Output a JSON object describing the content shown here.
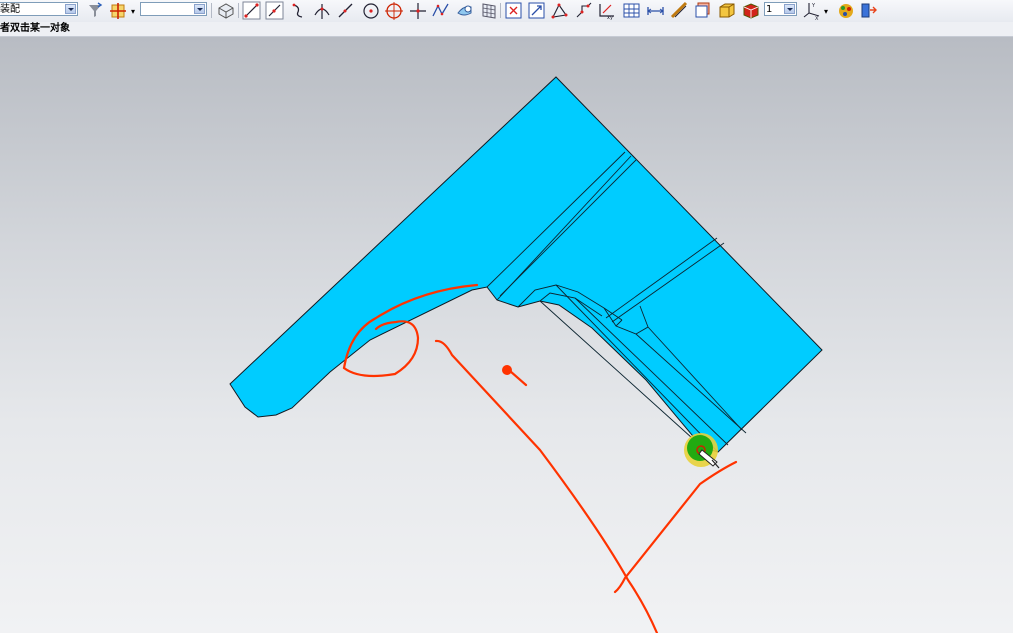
{
  "toolbar": {
    "assembly_dropdown": {
      "value": "装配"
    },
    "filter_dropdown": {
      "value": ""
    },
    "layer_dropdown": {
      "value": "1"
    },
    "icons": [
      "filter-icon",
      "snap-point-icon",
      "view-cube-icon",
      "line-icon",
      "line-tangent-icon",
      "arc-icon",
      "perpendicular-icon",
      "line-diagonal-icon",
      "circle-center-icon",
      "circle-icon",
      "point-icon",
      "spline-icon",
      "fill-icon",
      "grid-icon",
      "fit-view-icon",
      "zoom-region-icon",
      "dimension-icon",
      "analysis-icon",
      "measure-icon",
      "table-icon",
      "distance-icon",
      "curve-icon",
      "layers-icon",
      "box-icon",
      "shaded-cube-icon",
      "csys-icon",
      "palette-icon",
      "export-icon"
    ]
  },
  "status": {
    "prompt": "者双击某一对象"
  },
  "viewport": {
    "part_color": "#00ccff",
    "annotation_color": "#ff3300",
    "cursor_highlight_color": "#22aa11",
    "cursor_ring_color": "#e8d23a",
    "background_top": "#b8bcc3",
    "background_bottom": "#f1f2f4"
  }
}
